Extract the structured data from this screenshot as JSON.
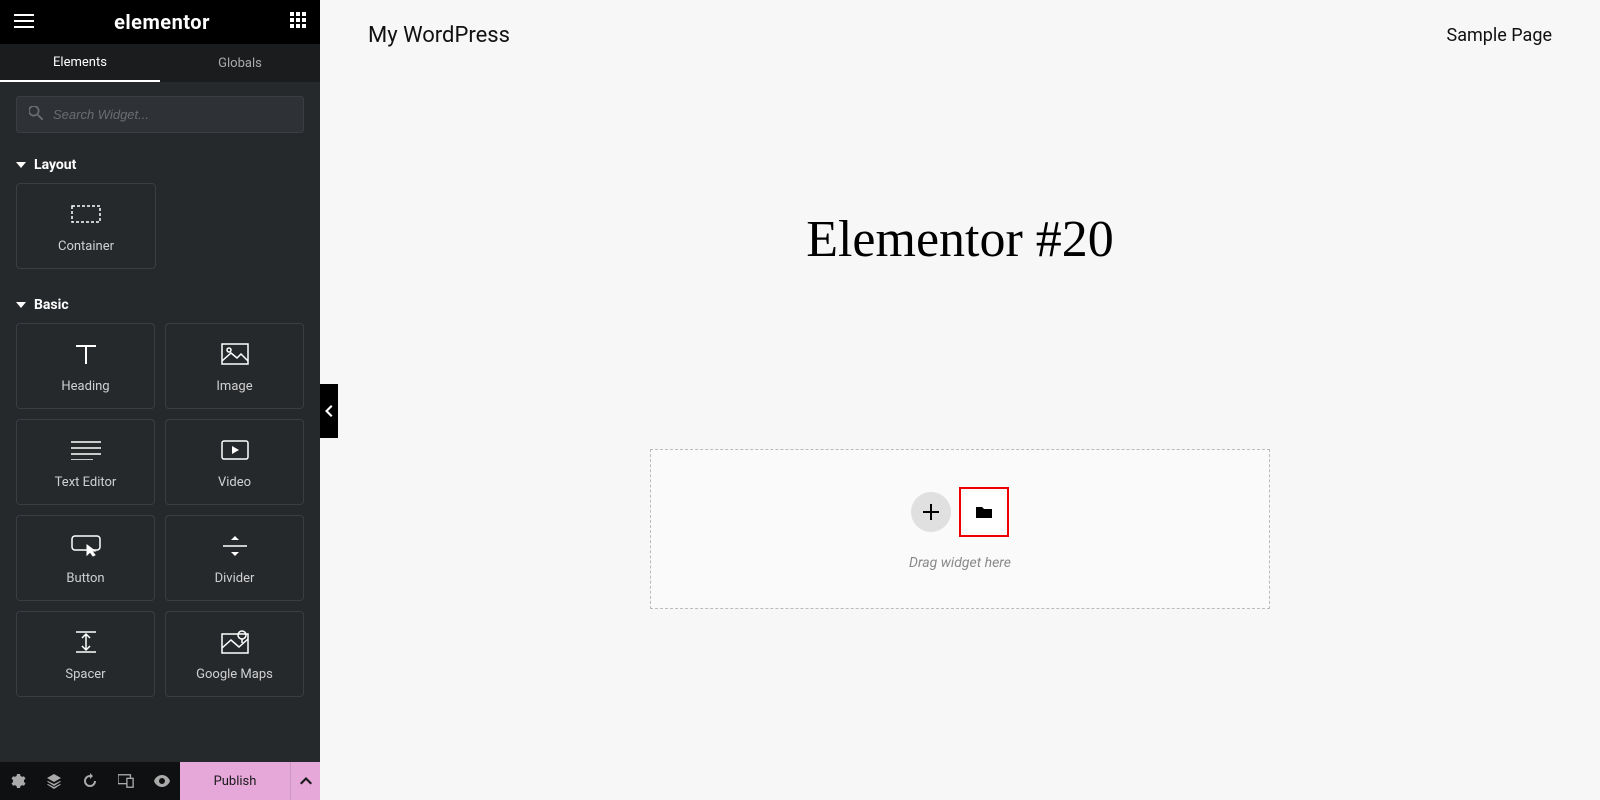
{
  "header": {
    "logo": "elementor"
  },
  "tabs": {
    "elements": "Elements",
    "globals": "Globals"
  },
  "search": {
    "placeholder": "Search Widget..."
  },
  "sections": {
    "layout": {
      "title": "Layout",
      "widgets": [
        {
          "label": "Container",
          "icon": "container-icon"
        }
      ]
    },
    "basic": {
      "title": "Basic",
      "widgets": [
        {
          "label": "Heading",
          "icon": "heading-icon"
        },
        {
          "label": "Image",
          "icon": "image-icon"
        },
        {
          "label": "Text Editor",
          "icon": "text-editor-icon"
        },
        {
          "label": "Video",
          "icon": "video-icon"
        },
        {
          "label": "Button",
          "icon": "button-icon"
        },
        {
          "label": "Divider",
          "icon": "divider-icon"
        },
        {
          "label": "Spacer",
          "icon": "spacer-icon"
        },
        {
          "label": "Google Maps",
          "icon": "google-maps-icon"
        }
      ]
    }
  },
  "bottom_bar": {
    "publish": "Publish"
  },
  "site": {
    "title": "My WordPress",
    "nav_link": "Sample Page"
  },
  "page": {
    "title": "Elementor #20"
  },
  "drop_zone": {
    "text": "Drag widget here"
  }
}
